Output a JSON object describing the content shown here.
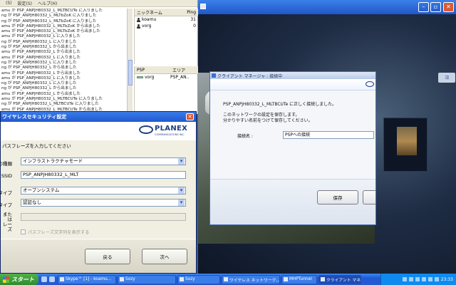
{
  "chat": {
    "menu": [
      "(S)",
      "設定(S)",
      "ヘルプ(H)"
    ],
    "log": [
      "amu が PSP_ANPJH80332_L_MLTBCUTe に入りました",
      "ng が PSP_ANPJH80332_L_MLTbZoK に入りました",
      "ng が PSP_ANPJH80332_L_MLTbZoK に入りました",
      "amu が PSP_ANPJH80332_L_MLTbZoK から出ました",
      "amu が PSP_ANPJH80332_L_MLTbZoK から出ました",
      "amu が PSP_ANPJH80332_L に入りました",
      "ng が PSP_ANPJH80332_L に入りました",
      "ng が PSP_ANPJH80332_L から出ました",
      "amu が PSP_ANPJH80332_L から出ました",
      "amu が PSP_ANPJH80332_L に入りました",
      "ng が PSP_ANPJH80332_L に入りました",
      "ng が PSP_ANPJH80332_L から出ました",
      "amu が PSP_ANPJH80332_L から出ました",
      "amu が PSP_ANPJH80332_L に入りました",
      "ng が PSP_ANPJH80332_L に入りました",
      "ng が PSP_ANPJH80332_L から出ました",
      "amu が PSP_ANPJH80332_L から出ました",
      "amu が PSP_ANPJH80332_L_MLTBCUTe に入りました",
      "ng が PSP_ANPJH80332_L_MLTBCUTe に入りました",
      "amu が PSP_ANPJH80332_L_MLTBCUTe から出ました"
    ],
    "nick_header": {
      "name": "ニックネーム",
      "ping": "Ping"
    },
    "users": [
      {
        "name": "koamu",
        "ping": "31"
      },
      {
        "name": "vorg",
        "ping": "0"
      }
    ],
    "psp_header": {
      "psp": "PSP",
      "area": "エリア"
    },
    "psp_rows": [
      {
        "name": "vorg",
        "area": "PSP_AN.."
      }
    ]
  },
  "security": {
    "title": "ワイヤレスセキュリティ設定",
    "brand": "PLANEX",
    "brand_sub": "COMMUNICATIONS INC.",
    "prompt": "パスフレーズを入力してください",
    "fields": [
      {
        "label": "の種類",
        "value": "インフラストラクチャモード"
      },
      {
        "label": "SSID",
        "value": "PSP_ANPJH80332_L_MLT"
      },
      {
        "label": "証タイプ",
        "value": "オープンシステム"
      },
      {
        "label": "化タイプ",
        "value": "認証なし"
      },
      {
        "label": "または\nレーズ",
        "value": ""
      }
    ],
    "checkbox_label": "パスフレーズ文字列を表示する",
    "back": "戻る",
    "next": "次へ"
  },
  "game": {
    "title_button": "▫",
    "side_button": "ヨ"
  },
  "client_manager": {
    "title": "クライアント マネージャ : 接続中",
    "line1": "PSP_ANPJH80332_L_MLTBCUTe に正しく接続しました。",
    "line2": "このネットワークの設定を保存します。",
    "line3": "分かりやすい名前をつけて保存してください。",
    "name_label": "接続名 :",
    "name_value": "PSPへの接続",
    "save": "保存"
  },
  "taskbar": {
    "start": "スタート",
    "tasks": [
      "Skype™ [1] - koamu...",
      "Sozy",
      "Sozy",
      "ワイヤレス ネットワーク...",
      "MHPTunnel",
      "クライアント マネージャ..."
    ],
    "clock": "23:33"
  },
  "colors": {
    "accent": "#1f59cf",
    "brand": "#1c3e86"
  }
}
